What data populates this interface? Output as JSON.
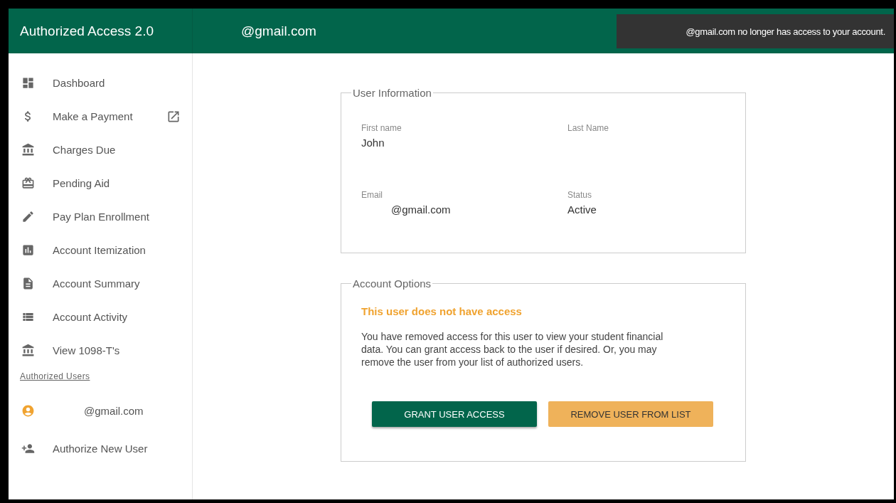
{
  "header": {
    "app_title": "Authorized Access 2.0",
    "user_email": "@gmail.com"
  },
  "toast": {
    "message": "@gmail.com no longer has access to your account."
  },
  "sidebar": {
    "items": [
      {
        "label": "Dashboard",
        "external": false
      },
      {
        "label": "Make a Payment",
        "external": true
      },
      {
        "label": "Charges Due",
        "external": false
      },
      {
        "label": "Pending Aid",
        "external": false
      },
      {
        "label": "Pay Plan Enrollment",
        "external": false
      },
      {
        "label": "Account Itemization",
        "external": false
      },
      {
        "label": "Account Summary",
        "external": false
      },
      {
        "label": "Account Activity",
        "external": false
      },
      {
        "label": "View 1098-T's",
        "external": false
      }
    ],
    "section_title": "Authorized Users",
    "users": [
      {
        "label": "@gmail.com",
        "color": "#f0a330"
      }
    ],
    "add_user": "Authorize New User"
  },
  "user_information": {
    "legend": "User Information",
    "fields": [
      {
        "label": "First name",
        "value": "John"
      },
      {
        "label": "Last Name"
      },
      {
        "label": "Email",
        "value": "@gmail.com",
        "indented": true
      },
      {
        "label": "Status",
        "value": "Active"
      }
    ]
  },
  "account_options": {
    "legend": "Account Options",
    "notice": "This user does not have access",
    "message": "You have removed access for this user to view your student financial data. You can grant access back to the user if desired. Or, you may remove the user from your list of authorized users.",
    "buttons": [
      {
        "label": "GRANT USER ACCESS",
        "kind": "primary"
      },
      {
        "label": "REMOVE USER FROM LIST",
        "kind": "warning"
      }
    ]
  }
}
